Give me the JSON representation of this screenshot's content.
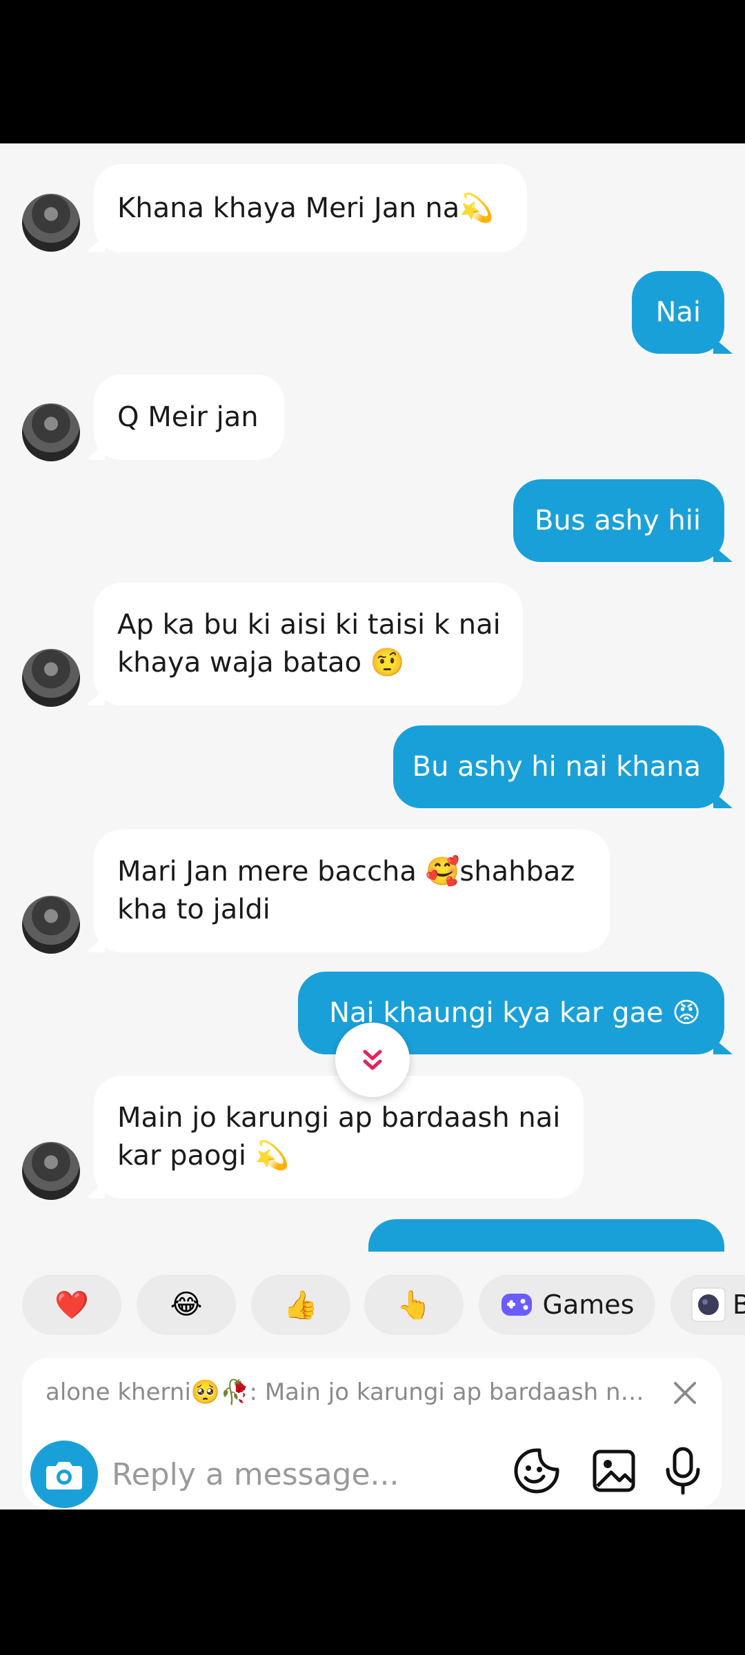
{
  "messages": [
    {
      "side": "in",
      "lines": [
        "Khana khaya Meri Jan na💫"
      ]
    },
    {
      "side": "out",
      "lines": [
        "Nai"
      ]
    },
    {
      "side": "in",
      "lines": [
        "Q Meir jan"
      ]
    },
    {
      "side": "out",
      "lines": [
        "Bus ashy hii"
      ]
    },
    {
      "side": "in",
      "lines": [
        "Ap ka bu ki aisi ki taisi k nai",
        "khaya waja batao 🤨"
      ]
    },
    {
      "side": "out",
      "lines": [
        "Bu ashy hi nai khana"
      ]
    },
    {
      "side": "in",
      "lines": [
        "Mari Jan mere baccha 🥰shahbaz",
        "kha to jaldi"
      ]
    },
    {
      "side": "out",
      "lines": [
        "Nai khaungi kya kar gae 😡"
      ]
    },
    {
      "side": "in",
      "lines": [
        "Main jo karungi ap bardaash nai",
        "kar paogi 💫"
      ]
    }
  ],
  "quick_replies": {
    "heart": "❤️",
    "laugh": "😂",
    "thumbs_up": "👍",
    "point_up": "👆",
    "games_label": "Games",
    "partial_label": "B"
  },
  "composer": {
    "quote": "alone  kherni🥺🥀: Main jo karungi ap bardaash na...",
    "placeholder": "Reply a message..."
  },
  "colors": {
    "accent": "#1aa0d8",
    "chat_bg": "#f6f6f6",
    "incoming_bubble": "#ffffff",
    "scroll_chevron": "#e0245e",
    "games_icon": "#6a5cff"
  }
}
